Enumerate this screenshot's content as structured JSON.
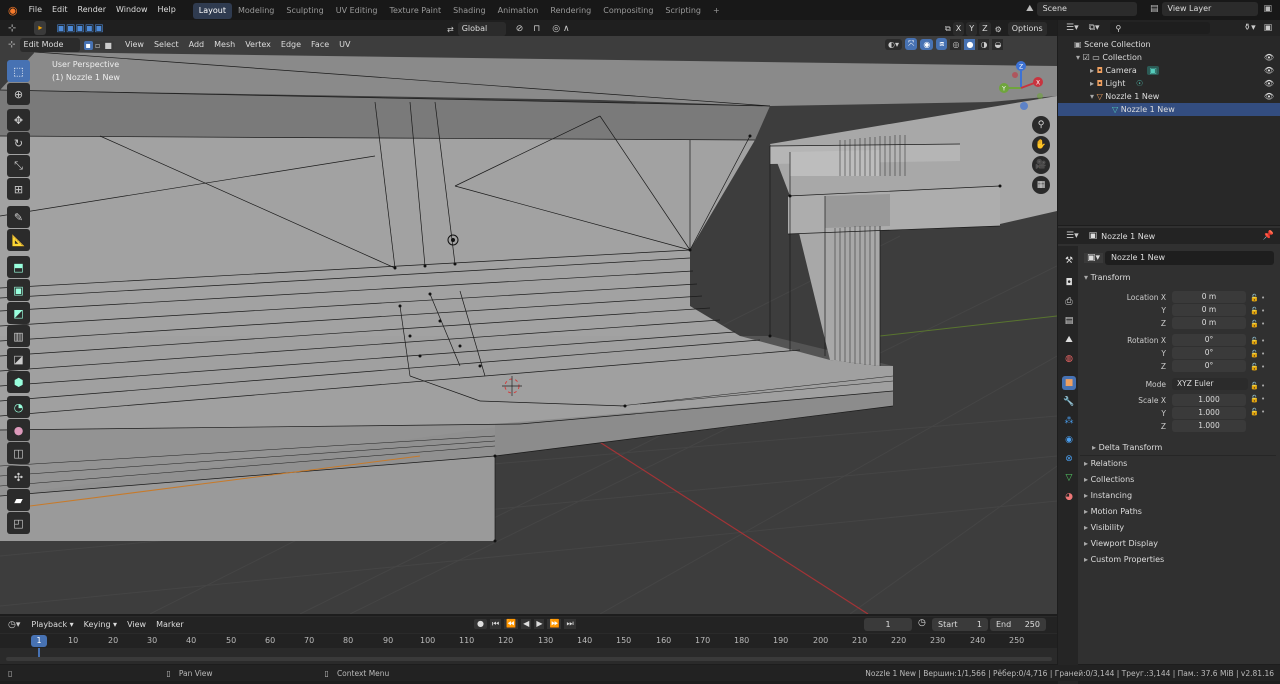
{
  "topbar": {
    "menus": [
      "File",
      "Edit",
      "Render",
      "Window",
      "Help"
    ],
    "workspaces": [
      "Layout",
      "Modeling",
      "Sculpting",
      "UV Editing",
      "Texture Paint",
      "Shading",
      "Animation",
      "Rendering",
      "Compositing",
      "Scripting"
    ],
    "active_workspace": "Layout",
    "add_tab": "+",
    "scene_label": "Scene",
    "view_layer_label": "View Layer"
  },
  "viewport_header": {
    "mode": "Edit Mode",
    "menus": [
      "View",
      "Select",
      "Add",
      "Mesh",
      "Vertex",
      "Edge",
      "Face",
      "UV"
    ],
    "transform_orientation": "Global",
    "axis_labels": [
      "X",
      "Y",
      "Z"
    ],
    "options_label": "Options"
  },
  "viewport": {
    "perspective_label": "User Perspective",
    "object_label": "(1) Nozzle 1 New",
    "gizmo_axes": {
      "x": "X",
      "y": "Y",
      "z": "Z"
    }
  },
  "outliner": {
    "search_placeholder": "",
    "root": "Scene Collection",
    "items": [
      {
        "label": "Collection",
        "depth": 1
      },
      {
        "label": "Camera",
        "depth": 2
      },
      {
        "label": "Light",
        "depth": 2
      },
      {
        "label": "Nozzle 1 New",
        "depth": 2
      },
      {
        "label": "Nozzle 1 New",
        "depth": 3,
        "selected": true
      }
    ]
  },
  "properties": {
    "object_name_header": "Nozzle 1 New",
    "object_name_field": "Nozzle 1 New",
    "transform_title": "Transform",
    "location_label": "Location X",
    "location": [
      "0 m",
      "0 m",
      "0 m"
    ],
    "rotation_label": "Rotation X",
    "rotation": [
      "0°",
      "0°",
      "0°"
    ],
    "mode_label": "Mode",
    "mode_value": "XYZ Euler",
    "scale_label": "Scale X",
    "scale": [
      "1.000",
      "1.000",
      "1.000"
    ],
    "axis_y": "Y",
    "axis_z": "Z",
    "delta_transform": "Delta Transform",
    "sections": [
      "Relations",
      "Collections",
      "Instancing",
      "Motion Paths",
      "Visibility",
      "Viewport Display",
      "Custom Properties"
    ]
  },
  "timeline": {
    "menus": [
      "Playback",
      "Keying",
      "View",
      "Marker"
    ],
    "current_frame": "1",
    "start_label": "Start",
    "start_value": "1",
    "end_label": "End",
    "end_value": "250",
    "ruler": [
      "1",
      "10",
      "20",
      "30",
      "40",
      "50",
      "60",
      "70",
      "80",
      "90",
      "100",
      "110",
      "120",
      "130",
      "140",
      "150",
      "160",
      "170",
      "180",
      "190",
      "200",
      "210",
      "220",
      "230",
      "240",
      "250"
    ]
  },
  "statusbar": {
    "pan_view": "Pan View",
    "context_menu": "Context Menu",
    "stats": "Nozzle 1 New | Вершин:1/1,566 | Рёбер:0/4,716 | Граней:0/3,144 | Треуг.:3,144 | Пам.: 37.6 MiB | v2.81.16"
  },
  "colors": {
    "accent": "#4772b3",
    "selected_row": "#334d80",
    "grid_bg": "#3d3d3d",
    "mesh_face": "#a3a3a3",
    "x_axis": "#c8343f",
    "y_axis": "#6fa53c",
    "z_axis": "#3d72d4"
  }
}
